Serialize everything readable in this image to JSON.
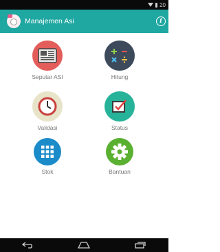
{
  "status_bar": {
    "time": "20",
    "wifi_icon": "wifi-icon",
    "battery_icon": "battery-icon"
  },
  "app_bar": {
    "title": "Manajemen Asi",
    "logo_icon": "baby-logo-icon",
    "info_icon": "info-icon",
    "info_glyph": "i",
    "color": "#1fa7a1"
  },
  "menu": [
    {
      "label": "Seputar ASI",
      "icon": "newspaper-icon",
      "color": "#e35d5b"
    },
    {
      "label": "Hitung",
      "icon": "calculator-icon",
      "color": "#3d4a5c"
    },
    {
      "label": "Validasi",
      "icon": "clock-icon",
      "color": "#e7e4c9"
    },
    {
      "label": "Status",
      "icon": "checkbox-icon",
      "color": "#26b39a"
    },
    {
      "label": "Stok",
      "icon": "grid-icon",
      "color": "#1c8bc9"
    },
    {
      "label": "Bantuan",
      "icon": "gear-icon",
      "color": "#5ab031"
    }
  ],
  "nav_bar": {
    "back_icon": "back-icon",
    "home_icon": "home-icon",
    "recents_icon": "recents-icon"
  }
}
